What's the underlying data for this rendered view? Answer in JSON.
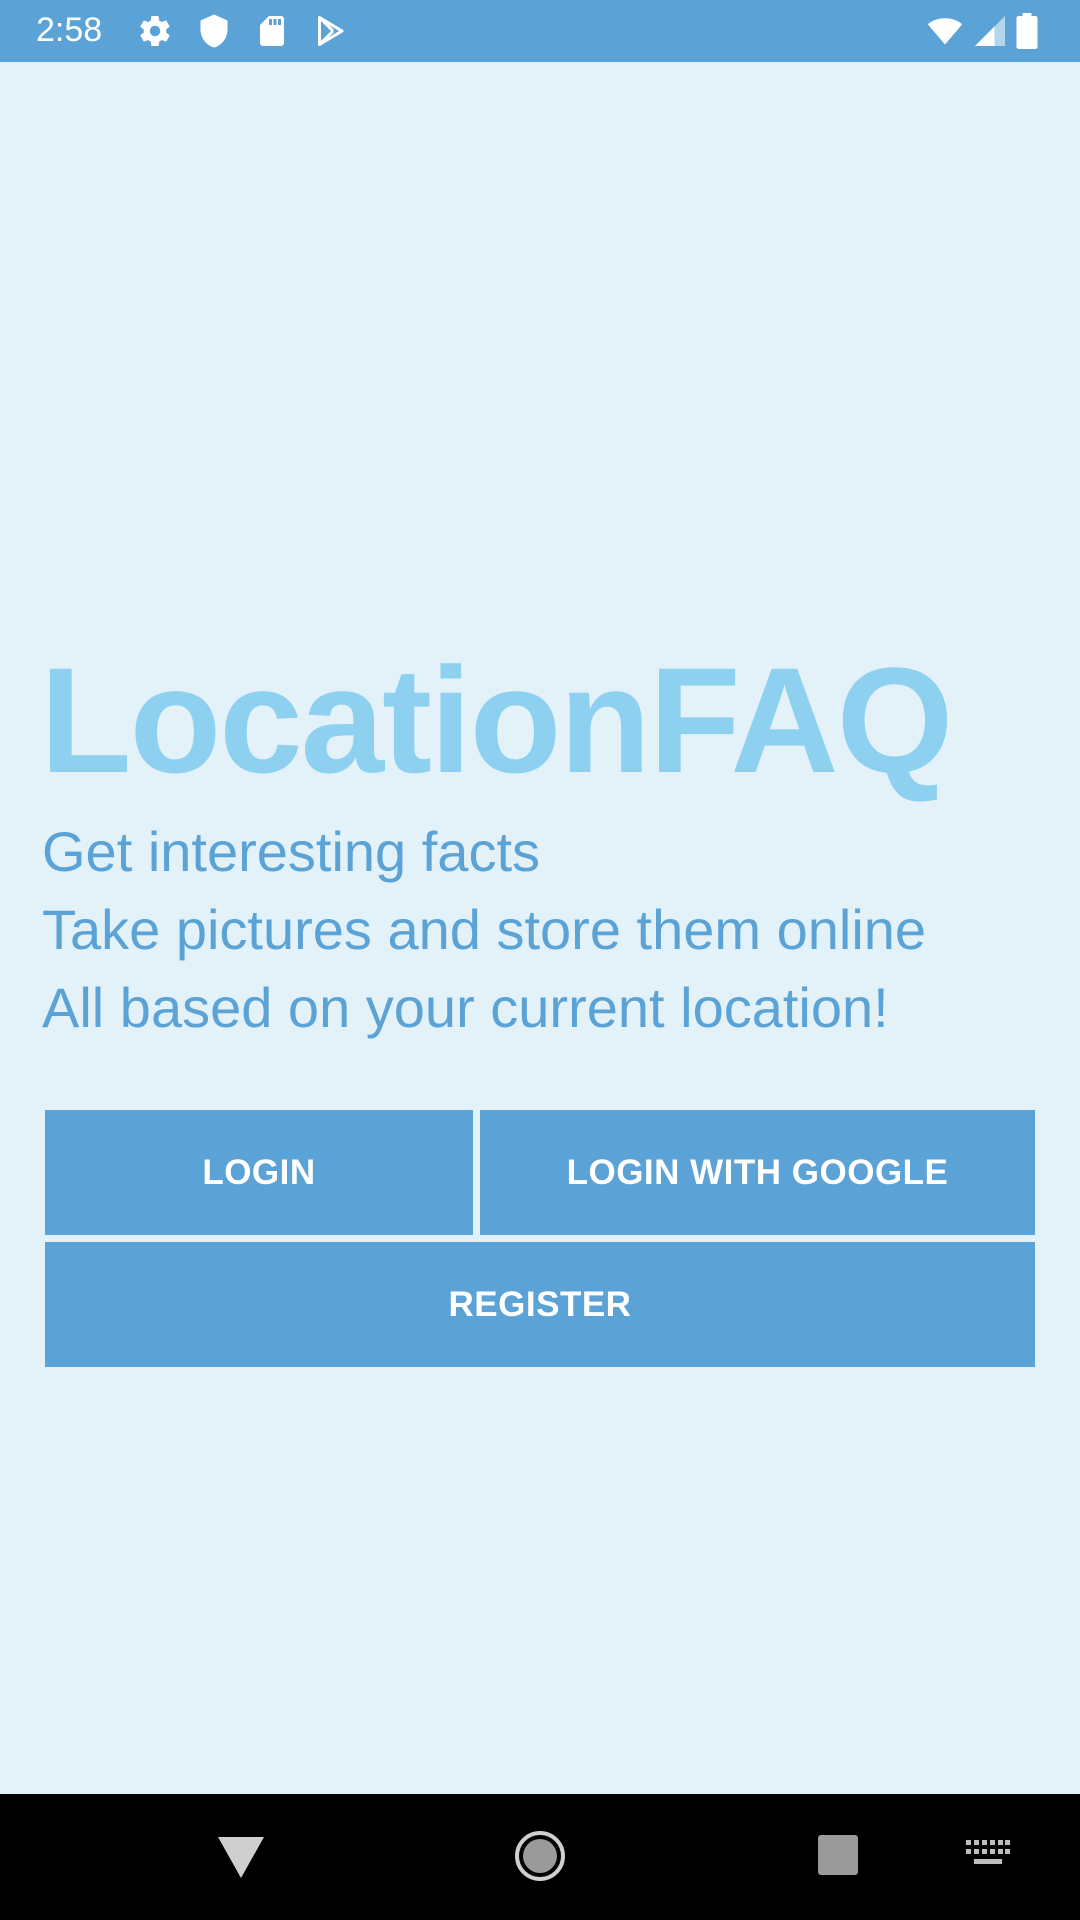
{
  "status_bar": {
    "time": "2:58",
    "icons": [
      "settings-icon",
      "shield-icon",
      "sd-card-icon",
      "play-store-icon",
      "wifi-icon",
      "signal-icon",
      "battery-icon"
    ]
  },
  "main": {
    "title": "LocationFAQ",
    "taglines": [
      "Get interesting facts",
      "Take pictures and store them online",
      "All based on your current location!"
    ],
    "buttons": {
      "login": "LOGIN",
      "login_google": "LOGIN WITH GOOGLE",
      "register": "REGISTER"
    }
  },
  "nav_bar": {
    "icons": [
      "back-icon",
      "home-icon",
      "recents-icon",
      "keyboard-icon"
    ]
  },
  "colors": {
    "status_bar": "#5ba3d6",
    "background": "#e3f1f9",
    "title": "#8dd0ef",
    "accent": "#5ba3d6",
    "nav_bar": "#000000"
  }
}
